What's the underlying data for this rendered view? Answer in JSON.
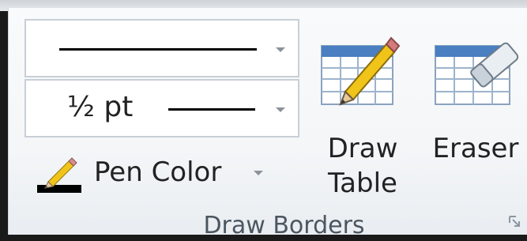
{
  "group": {
    "title": "Draw Borders"
  },
  "line_style": {
    "control": "dropdown",
    "value": "solid"
  },
  "line_weight": {
    "control": "dropdown",
    "value_label": "½ pt"
  },
  "pen_color": {
    "label": "Pen Color",
    "swatch_color": "#000000"
  },
  "draw_table": {
    "label_line1": "Draw",
    "label_line2": "Table",
    "icon": "draw-table-icon"
  },
  "eraser": {
    "label": "Eraser",
    "icon": "eraser-icon"
  },
  "colors": {
    "table_header_blue": "#4a7fc1",
    "pencil_yellow": "#f0c419"
  }
}
